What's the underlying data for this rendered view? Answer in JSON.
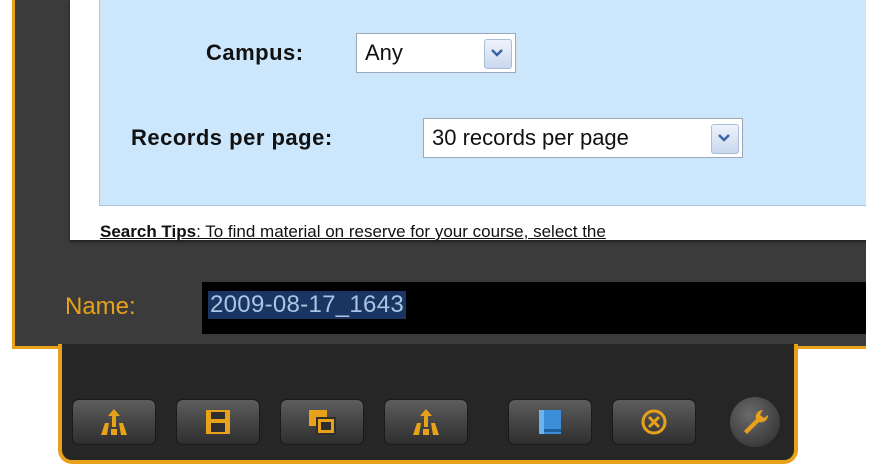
{
  "form": {
    "campus_label": "Campus:",
    "campus_value": "Any",
    "records_label": "Records per page:",
    "records_value": "30 records per page"
  },
  "search_tips": {
    "title": "Search Tips",
    "text": ": To find material on reserve for your course, select the"
  },
  "name_field": {
    "label": "Name:",
    "value": "2009-08-17_1643"
  },
  "toolbar": {
    "icons": [
      "upload-icon",
      "save-icon",
      "copy-icon",
      "upload-icon",
      "book-icon",
      "cancel-icon",
      "wrench-icon"
    ]
  },
  "colors": {
    "accent": "#e7a21a",
    "panel_bg": "#cce6fb",
    "frame_bg": "#3b3b3b",
    "selection_bg": "#1a3562"
  }
}
